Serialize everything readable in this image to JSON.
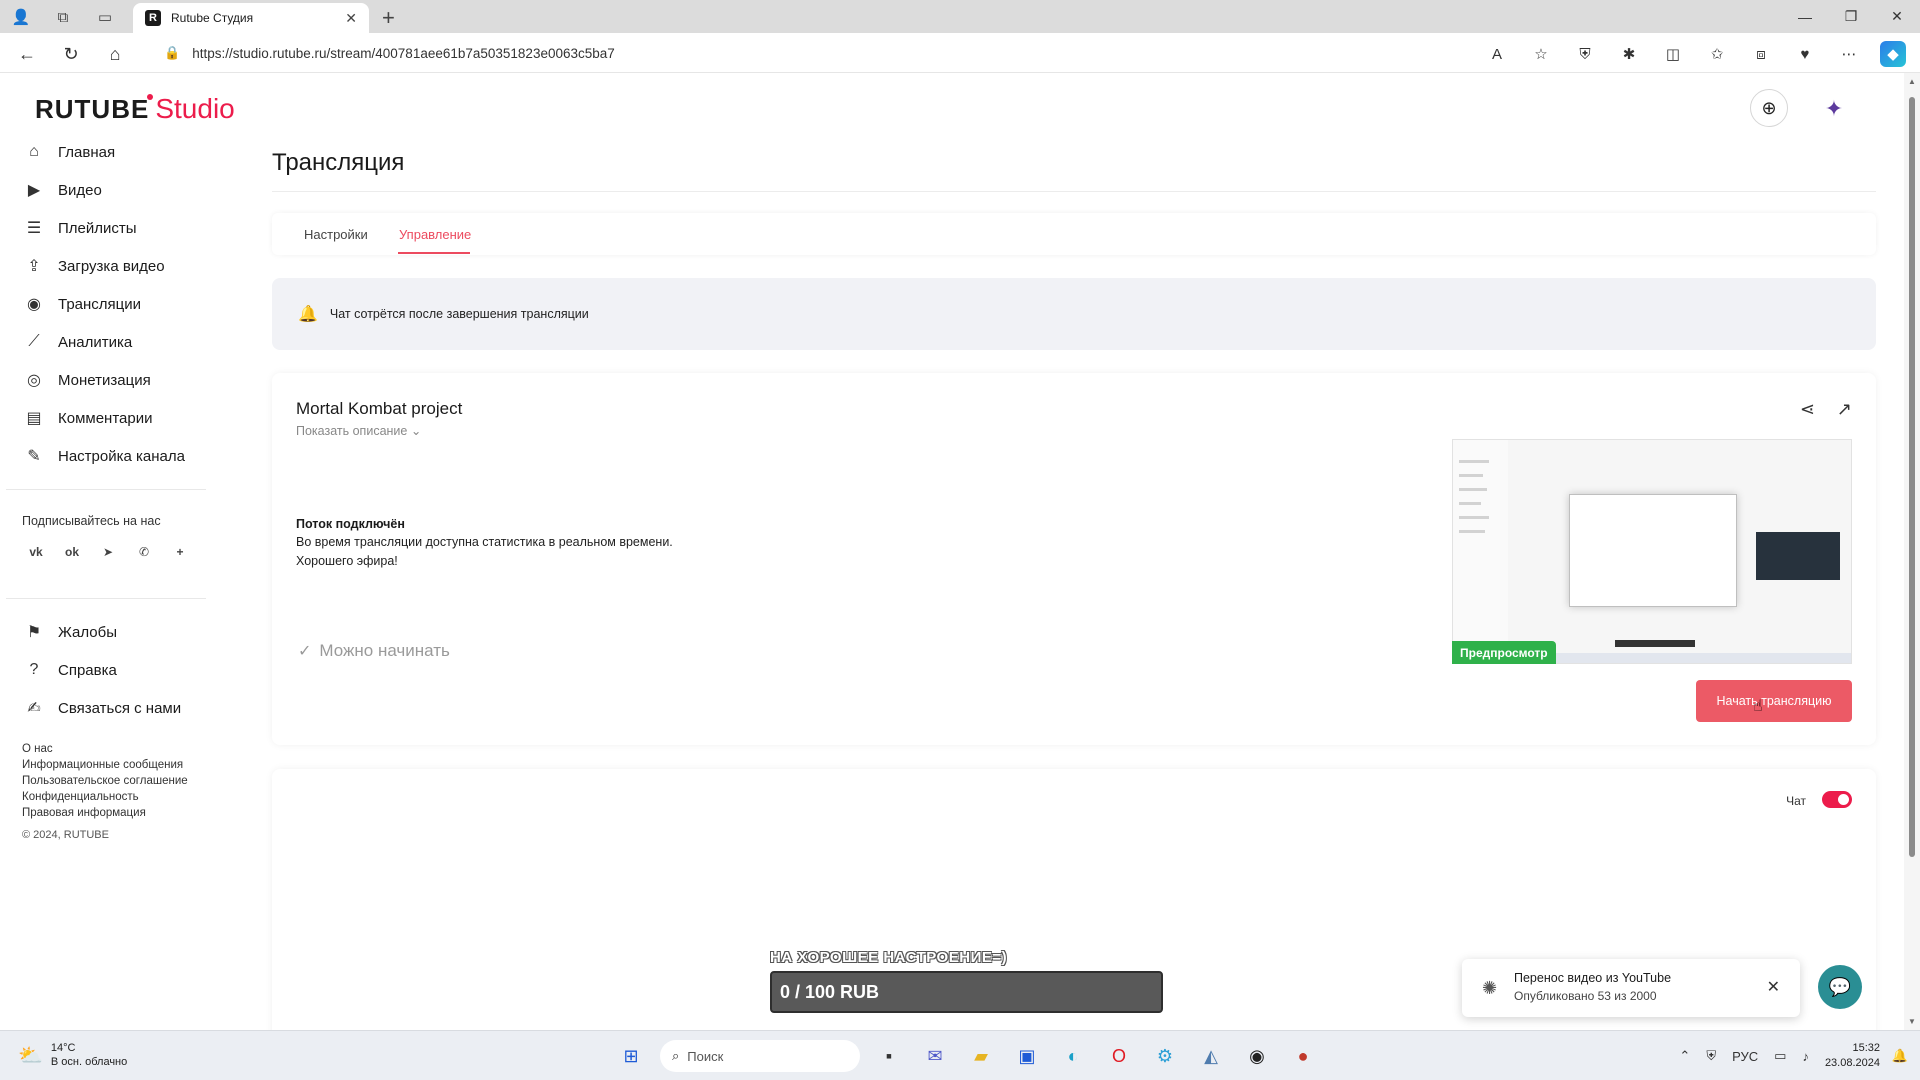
{
  "browser": {
    "tab_title": "Rutube Студия",
    "tab_favicon": "R",
    "url": "https://studio.rutube.ru/stream/400781aee61b7a50351823e0063c5ba7"
  },
  "app": {
    "logo_main": "RUTUBE",
    "logo_sub": "Studio",
    "brand_color": "#ec1c4b"
  },
  "sidebar": {
    "items": [
      {
        "label": "Главная",
        "icon": "home-icon"
      },
      {
        "label": "Видео",
        "icon": "video-icon"
      },
      {
        "label": "Плейлисты",
        "icon": "playlist-icon"
      },
      {
        "label": "Загрузка видео",
        "icon": "upload-icon"
      },
      {
        "label": "Трансляции",
        "icon": "broadcast-icon"
      },
      {
        "label": "Аналитика",
        "icon": "analytics-icon"
      },
      {
        "label": "Монетизация",
        "icon": "monetization-icon"
      },
      {
        "label": "Комментарии",
        "icon": "comments-icon"
      },
      {
        "label": "Настройка канала",
        "icon": "channel-settings-icon"
      }
    ],
    "subscribe_title": "Подписывайтесь на нас",
    "social": [
      "vk",
      "ok",
      "telegram",
      "viber",
      "more"
    ],
    "help_items": [
      {
        "label": "Жалобы",
        "icon": "flag-icon"
      },
      {
        "label": "Справка",
        "icon": "help-icon"
      },
      {
        "label": "Связаться с нами",
        "icon": "contact-icon"
      }
    ],
    "footer_links": [
      "О нас",
      "Информационные сообщения",
      "Пользовательское соглашение",
      "Конфиденциальность",
      "Правовая информация"
    ],
    "copyright": "© 2024, RUTUBE"
  },
  "main": {
    "page_title": "Трансляция",
    "tabs": [
      {
        "label": "Настройки"
      },
      {
        "label": "Управление",
        "active": true
      }
    ],
    "notice": "Чат сотрётся после завершения трансляции",
    "stream": {
      "title": "Mortal Kombat project",
      "show_description": "Показать описание",
      "status_title": "Поток подключён",
      "status_line1": "Во время трансляции доступна статистика в реальном времени.",
      "status_line2": "Хорошего эфира!",
      "ready_label": "Можно начинать",
      "preview_label": "Предпросмотр",
      "start_button": "Начать трансляцию"
    },
    "chat": {
      "label": "Чат",
      "enabled": true
    },
    "donation": {
      "label": "НА ХОРОШЕЕ НАСТРОЕНИЕ=)",
      "amount": "0 / 100 RUB"
    },
    "toast": {
      "title": "Перенос видео из YouTube",
      "subtitle": "Опубликовано 53 из 2000"
    }
  },
  "taskbar": {
    "temperature": "14°C",
    "weather": "В осн. облачно",
    "search_placeholder": "Поиск",
    "lang": "РУС",
    "time": "15:32",
    "date": "23.08.2024"
  }
}
